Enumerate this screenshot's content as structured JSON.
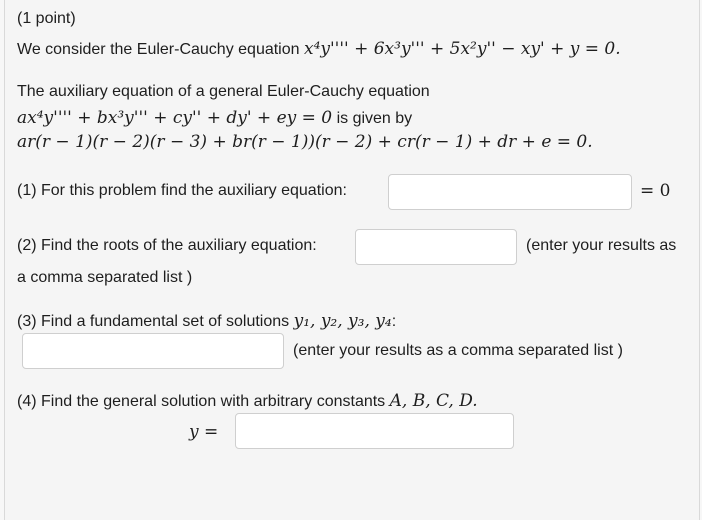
{
  "header": {
    "points": "(1 point)"
  },
  "intro": {
    "prefix": "We consider the Euler-Cauchy equation ",
    "equation": "x⁴y'''' + 6x³y''' + 5x²y'' − xy' + y = 0."
  },
  "aux": {
    "line1": "The auxiliary equation of a general Euler-Cauchy equation",
    "line2_math": "ax⁴y'''' + bx³y''' + cy'' + dy' + ey = 0",
    "line2_text": " is given by",
    "line3_math": "ar(r − 1)(r − 2)(r − 3) + br(r − 1))(r − 2) + cr(r − 1) + dr + e = 0."
  },
  "q1": {
    "label": "(1) For this problem find the auxiliary equation:",
    "suffix": "= 0",
    "value": ""
  },
  "q2": {
    "label": "(2) Find the roots of the auxiliary equation:",
    "hint": "(enter your results as",
    "hint_cont": "a comma separated list )",
    "value": ""
  },
  "q3": {
    "label": "(3) Find a fundamental set of solutions ",
    "label_math": "y₁, y₂, y₃, y₄",
    "label_end": ":",
    "hint": "(enter your results as a comma separated list )",
    "value": ""
  },
  "q4": {
    "label": "(4) Find the general solution with arbitrary constants ",
    "label_math": "A, B, C, D.",
    "y_label": "y =",
    "value": ""
  }
}
